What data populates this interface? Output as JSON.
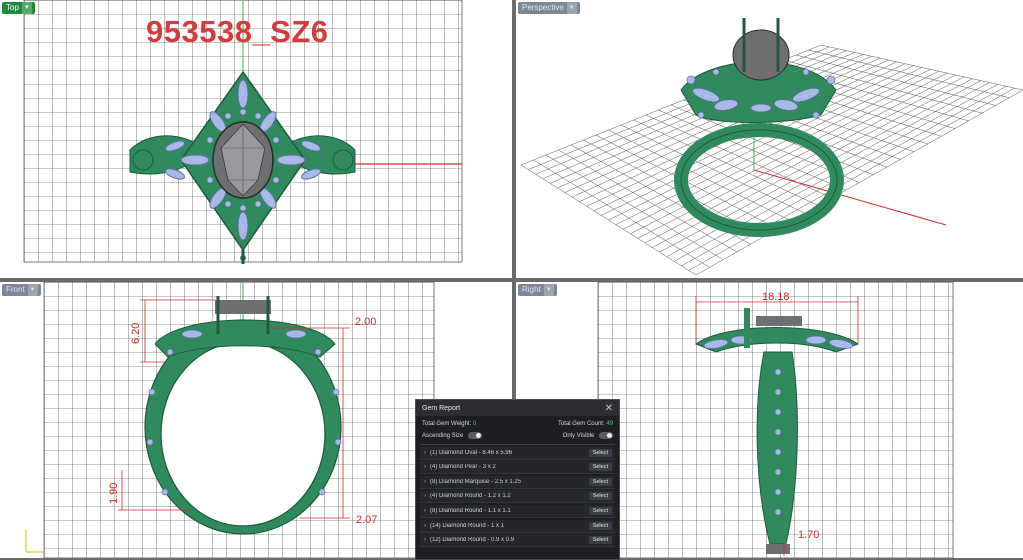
{
  "viewports": {
    "top": {
      "label": "Top"
    },
    "perspective": {
      "label": "Perspective"
    },
    "front": {
      "label": "Front"
    },
    "right": {
      "label": "Right"
    }
  },
  "model_label": "953538_SZ6",
  "dimensions": {
    "front_height": "6.20",
    "front_width_top": "2.00",
    "front_bottom_height": "1.90",
    "front_width_bottom": "2.07",
    "right_top_width": "18.18",
    "right_bottom_width": "1.70"
  },
  "gem_report": {
    "title": "Gem Report",
    "total_weight_label": "Total Gem Weight:",
    "total_weight_value": "0",
    "total_count_label": "Total Gem Count:",
    "total_count_value": "49",
    "ascending_label": "Ascending Size",
    "only_visible_label": "Only Visible",
    "select_label": "Select",
    "gems": [
      "(1) Diamond Oval - 8.46 x 5.96",
      "(4) Diamond Pear - 3 x 2",
      "(8) Diamond Marquise - 2.5 x 1.25",
      "(4) Diamond Round - 1.2 x 1.2",
      "(8) Diamond Round - 1.1 x 1.1",
      "(14) Diamond Round - 1 x 1",
      "(12) Diamond Round - 0.9 x 0.9"
    ]
  },
  "colors": {
    "metal": "#2f8a5c",
    "gem": "#a9b8e6",
    "center_stone": "#6f6f72",
    "axis_red": "#d42a2a",
    "axis_green": "#2bbf3a",
    "active_tab": "#1f8a3c"
  }
}
